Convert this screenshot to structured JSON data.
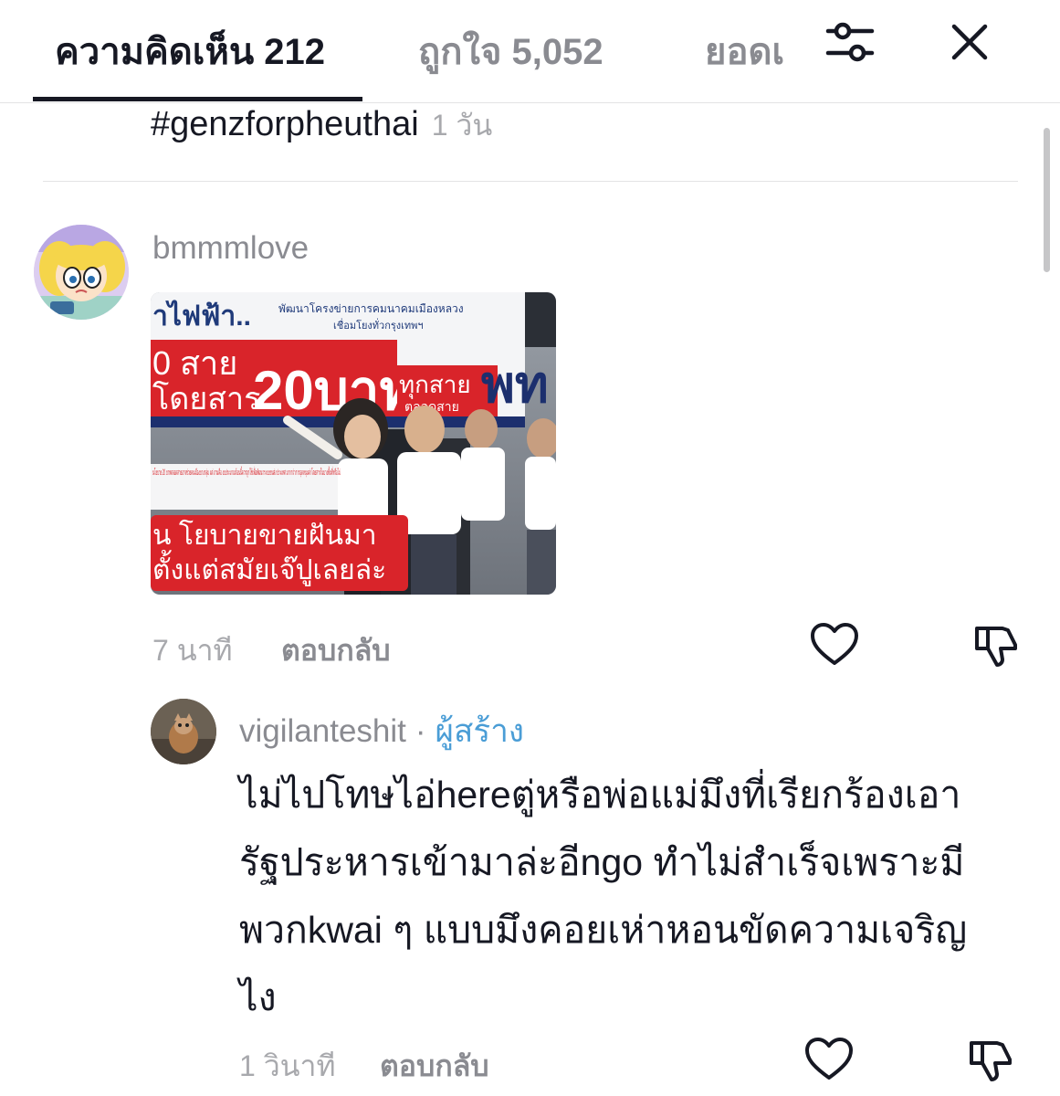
{
  "tabs": {
    "comments_label": "ความคิดเห็น 212",
    "likes_label": "ถูกใจ 5,052",
    "third_label": "ยอดเ"
  },
  "previous_comment": {
    "text": "#genzforpheuthai",
    "time": "1 วัน"
  },
  "comment": {
    "username": "bmmmlove",
    "time": "7 นาที",
    "reply_label": "ตอบกลับ",
    "image_text": {
      "top_left": "าไฟฟ้า..",
      "banner_top": "พัฒนาโครงข่ายการคมนาคมเมืองหลวง",
      "banner_sub": "เชื่อมโยงทั่วกรุงเทพฯ",
      "line1": "0 สาย",
      "line2": "โดยสาร",
      "big_price": "20บาท",
      "right_word": "ทุกสาย",
      "right_sub": "ตลอดสาย",
      "party": "พท",
      "caption_small": "นโยบาย 20 บาทตลอดสายอาจช่วยคนเมืองบางกลุ่ม แต่ ถามคือ งบประมาณก้อนนี้ควรถูกใช้เพื่อพัฒนาระบบขนส่ง ประเทศ มากกว่าการอุดหนุนค่าโดยสารในบางพื้นที่หรือไม่",
      "caption_big1": "น โยบายขายฝันมา",
      "caption_big2": "ตั้งแต่สมัยเจ๊ปูเลยล่ะ"
    }
  },
  "reply": {
    "username": "vigilanteshit",
    "separator": "·",
    "creator_badge": "ผู้สร้าง",
    "lines": [
      "ไม่ไปโทษไอ่hereตู่หรือพ่อแม่มึงที่เรียกร้องเอา",
      "รัฐประหารเข้ามาล่ะอีngo ทำไม่สำเร็จเพราะมี",
      "พวกkwai ๆ แบบมึงคอยเห่าหอนขัดความเจริญ",
      "ไง"
    ],
    "time": "1 วินาที",
    "reply_label": "ตอบกลับ"
  },
  "icons": {
    "filter": "sliders-icon",
    "close": "close-icon",
    "like": "heart-outline-icon",
    "dislike": "thumbs-down-icon"
  },
  "colors": {
    "text": "#161823",
    "muted": "#8a8b91",
    "creator": "#4a9dd6"
  }
}
